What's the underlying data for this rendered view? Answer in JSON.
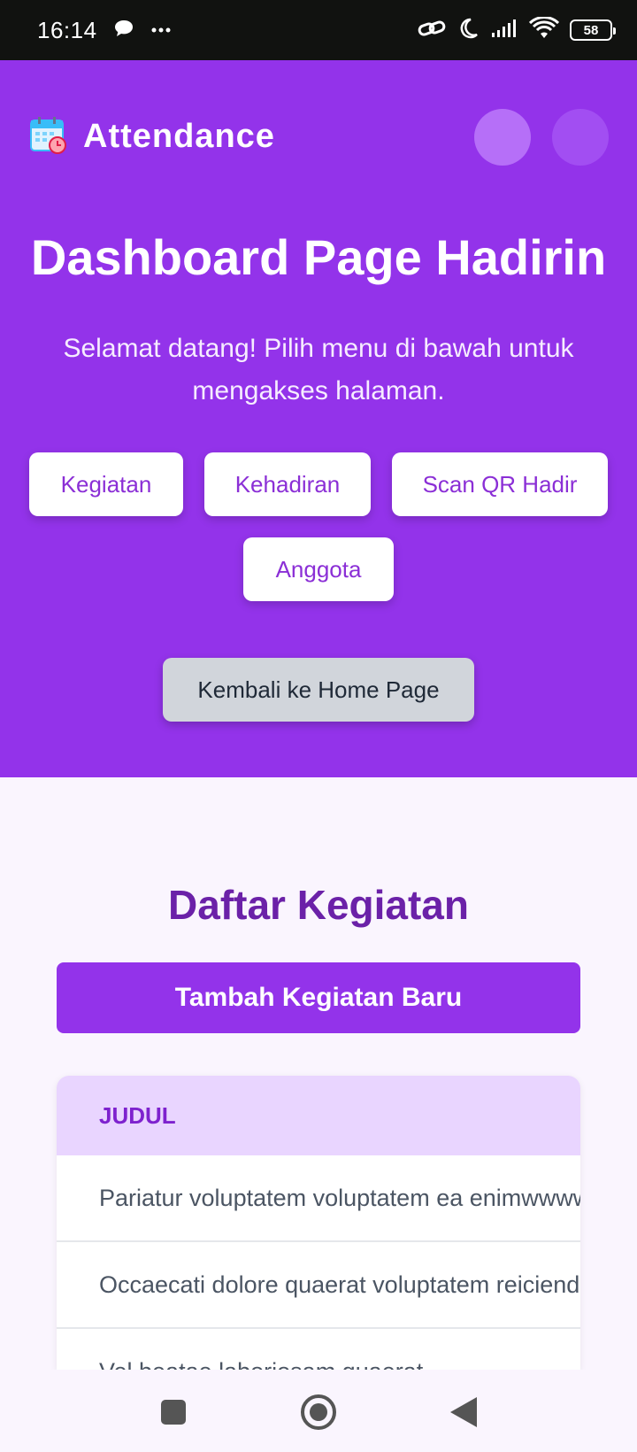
{
  "status_bar": {
    "time": "16:14",
    "battery": "58",
    "icons": [
      "chat-icon",
      "more-icon",
      "link-icon",
      "moon-icon",
      "signal-icon",
      "wifi-icon",
      "battery-icon"
    ]
  },
  "header": {
    "app_name": "Attendance",
    "logo_icon": "calendar-icon"
  },
  "hero": {
    "title": "Dashboard Page Hadirin",
    "subtitle": "Selamat datang! Pilih menu di bawah untuk mengakses halaman.",
    "menu": [
      {
        "label": "Kegiatan"
      },
      {
        "label": "Kehadiran"
      },
      {
        "label": "Scan QR Hadir"
      },
      {
        "label": "Anggota"
      }
    ],
    "home_button": "Kembali ke Home Page"
  },
  "activities": {
    "title": "Daftar Kegiatan",
    "add_button": "Tambah Kegiatan Baru",
    "table": {
      "header": "JUDUL",
      "rows": [
        "Pariatur voluptatem voluptatem ea enimwwww",
        "Occaecati dolore quaerat voluptatem reiciendis",
        "Vel beatae laboriosam quaerat"
      ]
    }
  },
  "colors": {
    "primary": "#9333ea",
    "primary_dark": "#6b21a8",
    "header_row": "#e9d5ff",
    "background": "#faf5fe"
  }
}
